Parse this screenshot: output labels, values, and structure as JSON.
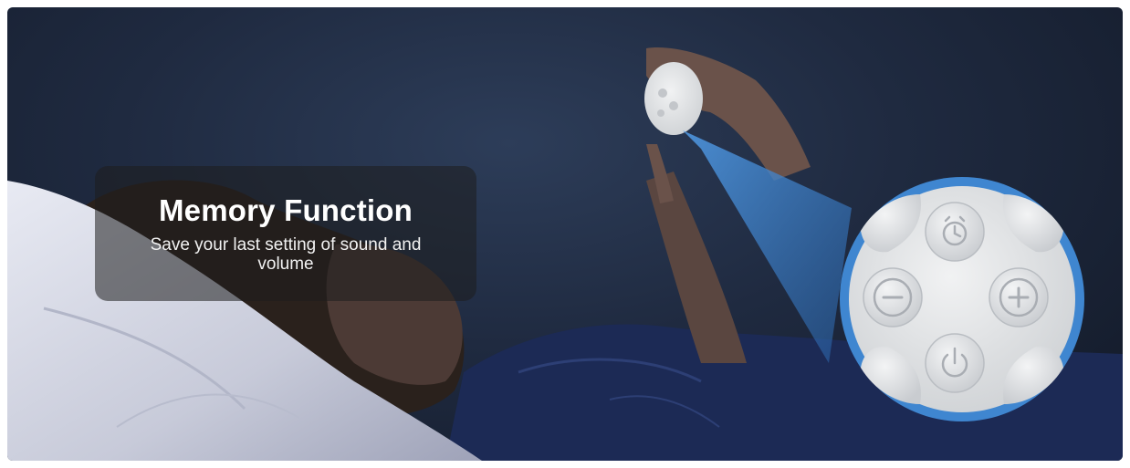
{
  "feature": {
    "title": "Memory Function",
    "description": "Save your last setting of sound and volume"
  },
  "device": {
    "buttons": [
      "timer-icon",
      "minus-icon",
      "plus-icon",
      "power-icon",
      "petal-icon"
    ]
  },
  "colors": {
    "background": "#1f2a40",
    "zoom_ring": "#3f86d0",
    "device": "#e3e5e6",
    "pillow": "#d9dbe6",
    "pajamas": "#1c2a55"
  }
}
